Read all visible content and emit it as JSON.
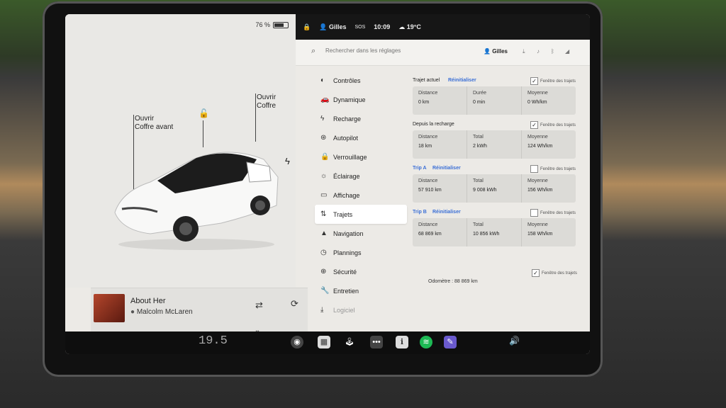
{
  "status": {
    "battery_percent": "76 %",
    "battery_level": 0.76,
    "driver": "Gilles",
    "sos": "SOS",
    "time": "10:09",
    "temperature": "19°C"
  },
  "car": {
    "front_trunk_label": "Ouvrir\nCoffre avant",
    "trunk_label": "Ouvrir\nCoffre"
  },
  "media": {
    "title": "About Her",
    "artist": "Malcolm McLaren"
  },
  "search": {
    "placeholder": "Rechercher dans les réglages",
    "user": "Gilles"
  },
  "menu": {
    "items": [
      {
        "label": "Contrôles",
        "icon": "toggle-icon"
      },
      {
        "label": "Dynamique",
        "icon": "car-icon"
      },
      {
        "label": "Recharge",
        "icon": "bolt-icon"
      },
      {
        "label": "Autopilot",
        "icon": "steering-icon"
      },
      {
        "label": "Verrouillage",
        "icon": "lock-icon"
      },
      {
        "label": "Éclairage",
        "icon": "sun-icon"
      },
      {
        "label": "Affichage",
        "icon": "display-icon"
      },
      {
        "label": "Trajets",
        "icon": "route-icon"
      },
      {
        "label": "Navigation",
        "icon": "navigation-icon"
      },
      {
        "label": "Plannings",
        "icon": "clock-icon"
      },
      {
        "label": "Sécurité",
        "icon": "shield-icon"
      },
      {
        "label": "Entretien",
        "icon": "wrench-icon"
      },
      {
        "label": "Logiciel",
        "icon": "download-icon"
      }
    ],
    "active_index": 7
  },
  "trips": {
    "current": {
      "title": "Trajet actuel",
      "reset": "Réinitialiser",
      "checkbox": "Fenêtre des trajets",
      "stats": [
        {
          "label": "Distance",
          "value": "0 km"
        },
        {
          "label": "Durée",
          "value": "0 min"
        },
        {
          "label": "Moyenne",
          "value": "0 Wh/km"
        }
      ]
    },
    "since_charge": {
      "title": "Depuis la recharge",
      "checkbox": "Fenêtre des trajets",
      "stats": [
        {
          "label": "Distance",
          "value": "18 km"
        },
        {
          "label": "Total",
          "value": "2 kWh"
        },
        {
          "label": "Moyenne",
          "value": "124 Wh/km"
        }
      ]
    },
    "trip_a": {
      "title": "Trip A",
      "reset": "Réinitialiser",
      "checkbox": "Fenêtre des trajets",
      "stats": [
        {
          "label": "Distance",
          "value": "57 910 km"
        },
        {
          "label": "Total",
          "value": "9 008 kWh"
        },
        {
          "label": "Moyenne",
          "value": "156 Wh/km"
        }
      ]
    },
    "trip_b": {
      "title": "Trip B",
      "reset": "Réinitialiser",
      "checkbox": "Fenêtre des trajets",
      "stats": [
        {
          "label": "Distance",
          "value": "68 869 km"
        },
        {
          "label": "Total",
          "value": "10 856 kWh"
        },
        {
          "label": "Moyenne",
          "value": "158 Wh/km"
        }
      ]
    },
    "bottom_checkbox": "Fenêtre des trajets",
    "odometer": "Odomètre : 88 869 km"
  },
  "dock": {
    "temperature": "19.5"
  }
}
